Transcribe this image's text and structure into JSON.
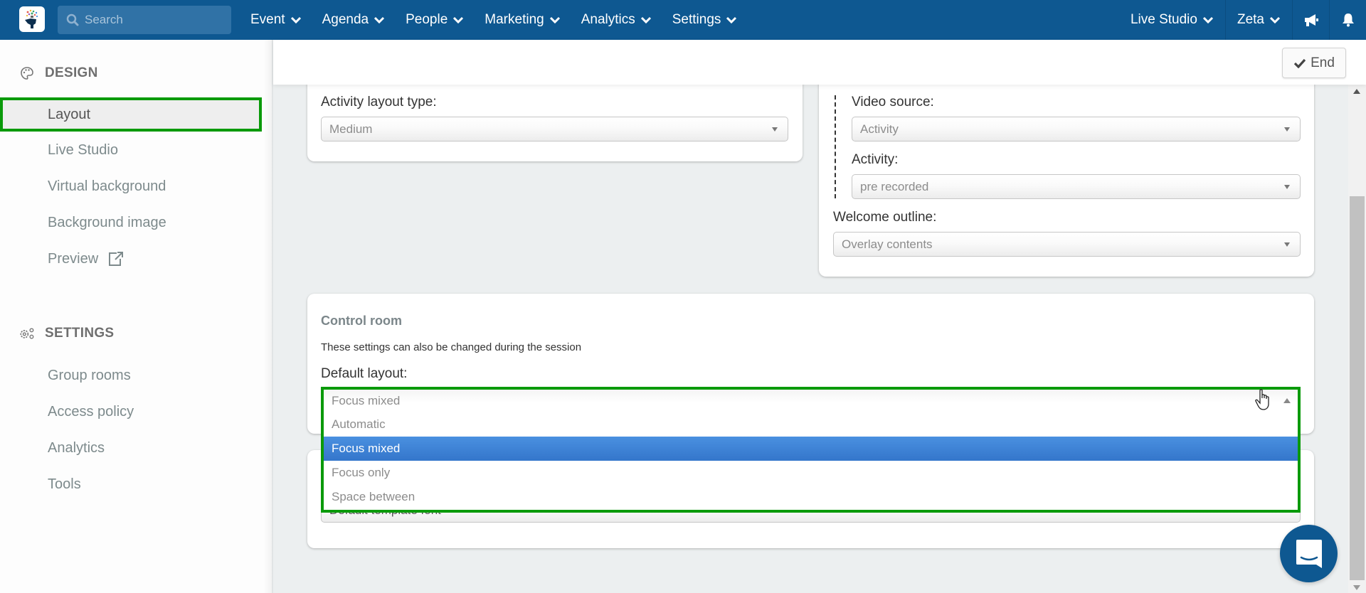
{
  "topbar": {
    "search_placeholder": "Search",
    "nav": [
      {
        "label": "Event"
      },
      {
        "label": "Agenda"
      },
      {
        "label": "People"
      },
      {
        "label": "Marketing"
      },
      {
        "label": "Analytics"
      },
      {
        "label": "Settings"
      }
    ],
    "right": {
      "studio_label": "Live Studio",
      "user_label": "Zeta"
    },
    "brand_color": "#0e5891"
  },
  "sidebar": {
    "design_header": "DESIGN",
    "design_items": [
      {
        "label": "Layout",
        "active": true
      },
      {
        "label": "Live Studio"
      },
      {
        "label": "Virtual background"
      },
      {
        "label": "Background image"
      },
      {
        "label": "Preview"
      }
    ],
    "settings_header": "SETTINGS",
    "settings_items": [
      {
        "label": "Group rooms"
      },
      {
        "label": "Access policy"
      },
      {
        "label": "Analytics"
      },
      {
        "label": "Tools"
      }
    ]
  },
  "header": {
    "end_label": "End"
  },
  "layout_card": {
    "activity_layout_label": "Activity layout type:",
    "activity_layout_value": "Medium"
  },
  "video_card": {
    "video_source_label": "Video source:",
    "video_source_value": "Activity",
    "activity_label": "Activity:",
    "activity_value": "pre recorded",
    "welcome_outline_label": "Welcome outline:",
    "welcome_outline_value": "Overlay contents"
  },
  "control_room": {
    "title": "Control room",
    "description": "These settings can also be changed during the session",
    "default_layout_label": "Default layout:",
    "default_layout_value": "Focus mixed",
    "options": [
      {
        "label": "Automatic"
      },
      {
        "label": "Focus mixed",
        "selected": true
      },
      {
        "label": "Focus only"
      },
      {
        "label": "Space between"
      }
    ]
  },
  "font_card": {
    "font_value": "Default template font"
  },
  "highlight_color": "#0a9a0a",
  "selected_option_color": "#3f83d6"
}
